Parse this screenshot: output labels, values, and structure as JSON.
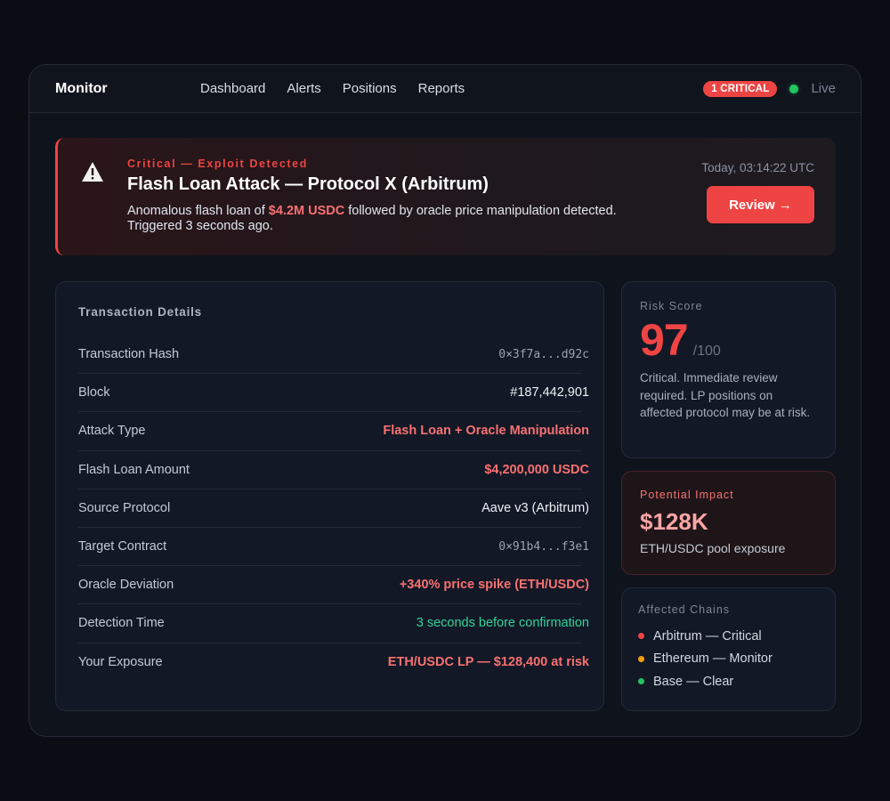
{
  "header": {
    "brand": "Monitor",
    "nav": [
      "Dashboard",
      "Alerts",
      "Positions",
      "Reports"
    ],
    "critical_badge": "1 CRITICAL",
    "status": "Live"
  },
  "alert": {
    "kicker": "Critical — Exploit Detected",
    "title": "Flash Loan Attack — Protocol X (Arbitrum)",
    "desc_prefix": "Anomalous flash loan of ",
    "desc_highlight": "$4.2M USDC",
    "desc_suffix": " followed by oracle price manipulation detected.",
    "desc_line2": "Triggered 3 seconds ago.",
    "timestamp": "Today, 03:14:22 UTC",
    "review_label": "Review →",
    "icon": "warning-triangle-icon"
  },
  "transaction": {
    "heading": "Transaction Details",
    "rows": [
      {
        "label": "Transaction Hash",
        "value": "0×3f7a...d92c",
        "style": "mono"
      },
      {
        "label": "Block",
        "value": "#187,442,901",
        "style": "plain"
      },
      {
        "label": "Attack Type",
        "value": "Flash Loan + Oracle Manipulation",
        "style": "danger"
      },
      {
        "label": "Flash Loan Amount",
        "value": "$4,200,000 USDC",
        "style": "danger"
      },
      {
        "label": "Source Protocol",
        "value": "Aave v3 (Arbitrum)",
        "style": "plain"
      },
      {
        "label": "Target Contract",
        "value": "0×91b4...f3e1",
        "style": "mono"
      },
      {
        "label": "Oracle Deviation",
        "value": "+340% price spike (ETH/USDC)",
        "style": "danger"
      },
      {
        "label": "Detection Time",
        "value": "3 seconds before confirmation",
        "style": "success"
      },
      {
        "label": "Your Exposure",
        "value": "ETH/USDC LP — $128,400 at risk",
        "style": "danger"
      }
    ]
  },
  "risk": {
    "label": "Risk Score",
    "score": "97",
    "max": "/100",
    "description": "Critical. Immediate review required. LP positions on affected protocol may be at risk."
  },
  "impact": {
    "label": "Potential Impact",
    "value": "$128K",
    "sub": "ETH/USDC pool exposure"
  },
  "chains": {
    "label": "Affected Chains",
    "items": [
      {
        "text": "Arbitrum — Critical",
        "color": "#ef4444"
      },
      {
        "text": "Ethereum — Monitor",
        "color": "#f59e0b"
      },
      {
        "text": "Base — Clear",
        "color": "#22c55e"
      }
    ]
  },
  "colors": {
    "critical": "#ef4444",
    "success": "#34d399",
    "background": "#0b0d14"
  }
}
